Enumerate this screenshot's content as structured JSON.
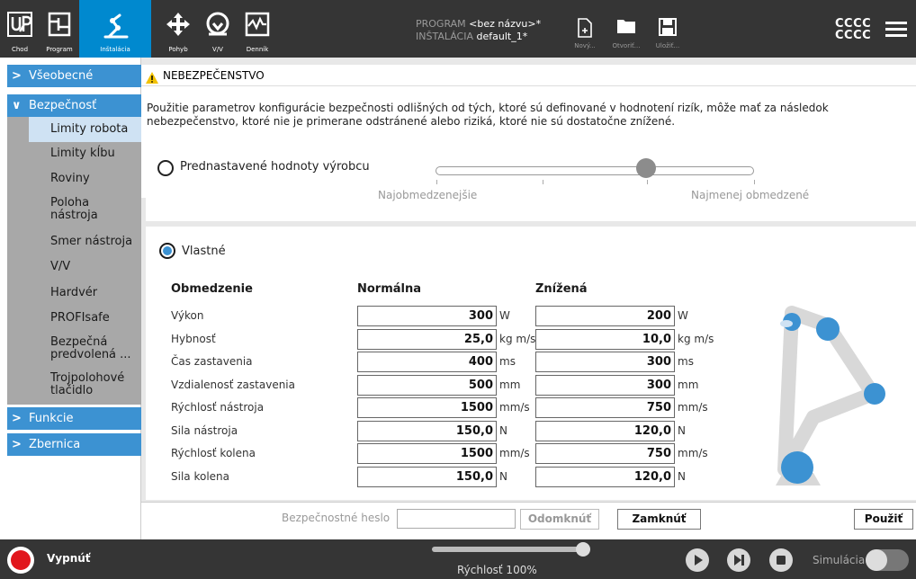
{
  "topbar": {
    "nav": [
      {
        "label": "Chod",
        "icon": "ur-logo-icon"
      },
      {
        "label": "Program",
        "icon": "program-icon"
      },
      {
        "label": "Inštalácia",
        "icon": "installation-icon",
        "active": true
      },
      {
        "label": "Pohyb",
        "icon": "move-icon"
      },
      {
        "label": "V/V",
        "icon": "io-icon"
      },
      {
        "label": "Denník",
        "icon": "log-icon"
      }
    ],
    "program_label": "PROGRAM",
    "program_value": "<bez názvu>*",
    "installation_label": "INŠTALÁCIA",
    "installation_value": "default_1*",
    "file_buttons": [
      {
        "label": "Nový...",
        "icon": "new-file-icon"
      },
      {
        "label": "Otvoriť...",
        "icon": "open-folder-icon"
      },
      {
        "label": "Uložiť...",
        "icon": "save-icon"
      }
    ],
    "user_line1": "CCCC",
    "user_line2": "CCCC",
    "accent": "#0089cf"
  },
  "sidebar": {
    "groups": [
      {
        "label": "Všeobecné",
        "expanded": false
      },
      {
        "label": "Bezpečnosť",
        "expanded": true
      },
      {
        "label": "Funkcie",
        "expanded": false
      },
      {
        "label": "Zbernica",
        "expanded": false
      }
    ],
    "safety_items": [
      {
        "label": "Limity robota",
        "selected": true
      },
      {
        "label": "Limity kĺbu"
      },
      {
        "label": "Roviny"
      },
      {
        "label": "Poloha nástroja"
      },
      {
        "label": "Smer nástroja"
      },
      {
        "label": "V/V"
      },
      {
        "label": "Hardvér"
      },
      {
        "label": "PROFIsafe"
      },
      {
        "label": "Bezpečná predvolená ..."
      },
      {
        "label": "Trojpolohové tlačidlo"
      }
    ],
    "group_color": "#3c92d2"
  },
  "main": {
    "warning_title": "NEBEZPEČENSTVO",
    "warning_text": "Použitie parametrov konfigurácie bezpečnosti odlišných od tých, ktoré sú definované v hodnotení rizík, môže mať za následok nebezpečenstvo, ktoré nie je primerane odstránené alebo riziká, ktoré nie sú dostatočne znížené.",
    "preset_label": "Prednastavené hodnoty výrobcu",
    "slider_left_label": "Najobmedzenejšie",
    "slider_right_label": "Najmenej obmedzené",
    "slider_position": 0.66,
    "custom_label": "Vlastné",
    "custom_selected": true,
    "columns": {
      "name": "Obmedzenie",
      "normal": "Normálna",
      "reduced": "Znížená"
    },
    "rows": [
      {
        "name": "Výkon",
        "normal": "300",
        "normal_unit": "W",
        "reduced": "200",
        "reduced_unit": "W"
      },
      {
        "name": "Hybnosť",
        "normal": "25,0",
        "normal_unit": "kg m/s",
        "reduced": "10,0",
        "reduced_unit": "kg m/s"
      },
      {
        "name": "Čas zastavenia",
        "normal": "400",
        "normal_unit": "ms",
        "reduced": "300",
        "reduced_unit": "ms"
      },
      {
        "name": "Vzdialenosť zastavenia",
        "normal": "500",
        "normal_unit": "mm",
        "reduced": "300",
        "reduced_unit": "mm"
      },
      {
        "name": "Rýchlosť nástroja",
        "normal": "1500",
        "normal_unit": "mm/s",
        "reduced": "750",
        "reduced_unit": "mm/s"
      },
      {
        "name": "Sila nástroja",
        "normal": "150,0",
        "normal_unit": "N",
        "reduced": "120,0",
        "reduced_unit": "N"
      },
      {
        "name": "Rýchlosť kolena",
        "normal": "1500",
        "normal_unit": "mm/s",
        "reduced": "750",
        "reduced_unit": "mm/s"
      },
      {
        "name": "Sila kolena",
        "normal": "150,0",
        "normal_unit": "N",
        "reduced": "120,0",
        "reduced_unit": "N"
      }
    ]
  },
  "bottom": {
    "password_label": "Bezpečnostné heslo",
    "password_value": "",
    "unlock_label": "Odomknúť",
    "lock_label": "Zamknúť",
    "apply_label": "Použiť"
  },
  "footer": {
    "power_label": "Vypnúť",
    "speed_label": "Rýchlosť 100%",
    "speed_value": 1.0,
    "simulation_label": "Simulácia",
    "simulation_on": false
  }
}
